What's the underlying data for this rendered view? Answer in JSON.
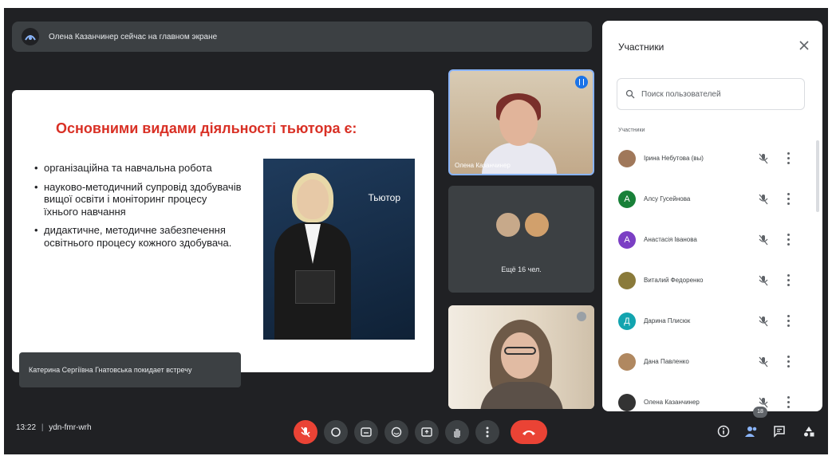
{
  "banner": {
    "text": "Олена Казанчинер сейчас на главном экране",
    "logo_icon": "meet-present-icon"
  },
  "slide": {
    "title": "Основними видами діяльності тьютора є:",
    "bullets": [
      "організаційна та навчальна робота",
      "науково-методичний супровід здобувачів вищої освіти і моніторинг процесу їхнього навчання",
      "дидактичне, методичне забезпечення освітнього процесу кожного здобувача."
    ],
    "image_caption": "Тьютор"
  },
  "toast": {
    "text": "Катерина Сергіївна Гнатовська покидает встречу"
  },
  "tiles": {
    "presenter_name": "Олена Казанчинер",
    "others_label": "Ещё 16 чел."
  },
  "panel": {
    "title": "Участники",
    "search_placeholder": "Поиск пользователей",
    "section_label": "Участники",
    "participants": [
      {
        "name": "Ірина Небутова (вы)",
        "initial": "",
        "color": "#a0785a"
      },
      {
        "name": "Алсу Гусейнова",
        "initial": "A",
        "color": "#188038"
      },
      {
        "name": "Анастасія Іванова",
        "initial": "A",
        "color": "#7b3fc4"
      },
      {
        "name": "Виталий Федоренко",
        "initial": "",
        "color": "#8a7a3a"
      },
      {
        "name": "Дарина Плиcюк",
        "initial": "Д",
        "color": "#12a4af"
      },
      {
        "name": "Дана Павленко",
        "initial": "",
        "color": "#b08860"
      },
      {
        "name": "Олена Казанчинер",
        "initial": "",
        "color": "#333333"
      }
    ]
  },
  "bottom": {
    "time": "13:22",
    "separator": "|",
    "meeting_code": "ydn-fmr-wrh",
    "participants_badge": "18"
  },
  "colors": {
    "leave_red": "#ea4335",
    "accent_blue": "#1a73e8",
    "bar_dark": "#202124"
  }
}
